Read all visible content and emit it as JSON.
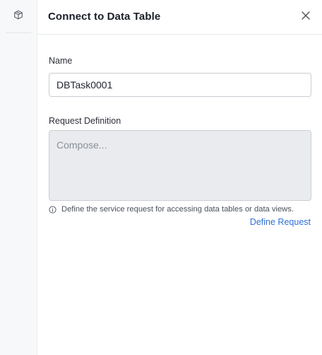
{
  "sidebar": {
    "icon": "cube-icon"
  },
  "header": {
    "title": "Connect to Data Table",
    "close_icon": "close-icon"
  },
  "form": {
    "name_label": "Name",
    "name_value": "DBTask0001",
    "request_label": "Request Definition",
    "request_placeholder": "Compose...",
    "hint_icon": "info-icon",
    "hint_text": "Define the service request for accessing data tables or data views.",
    "define_link": "Define Request"
  },
  "colors": {
    "link": "#2f6fd6",
    "compose_bg": "#e9ebee",
    "rail_bg": "#f7f8fa"
  }
}
